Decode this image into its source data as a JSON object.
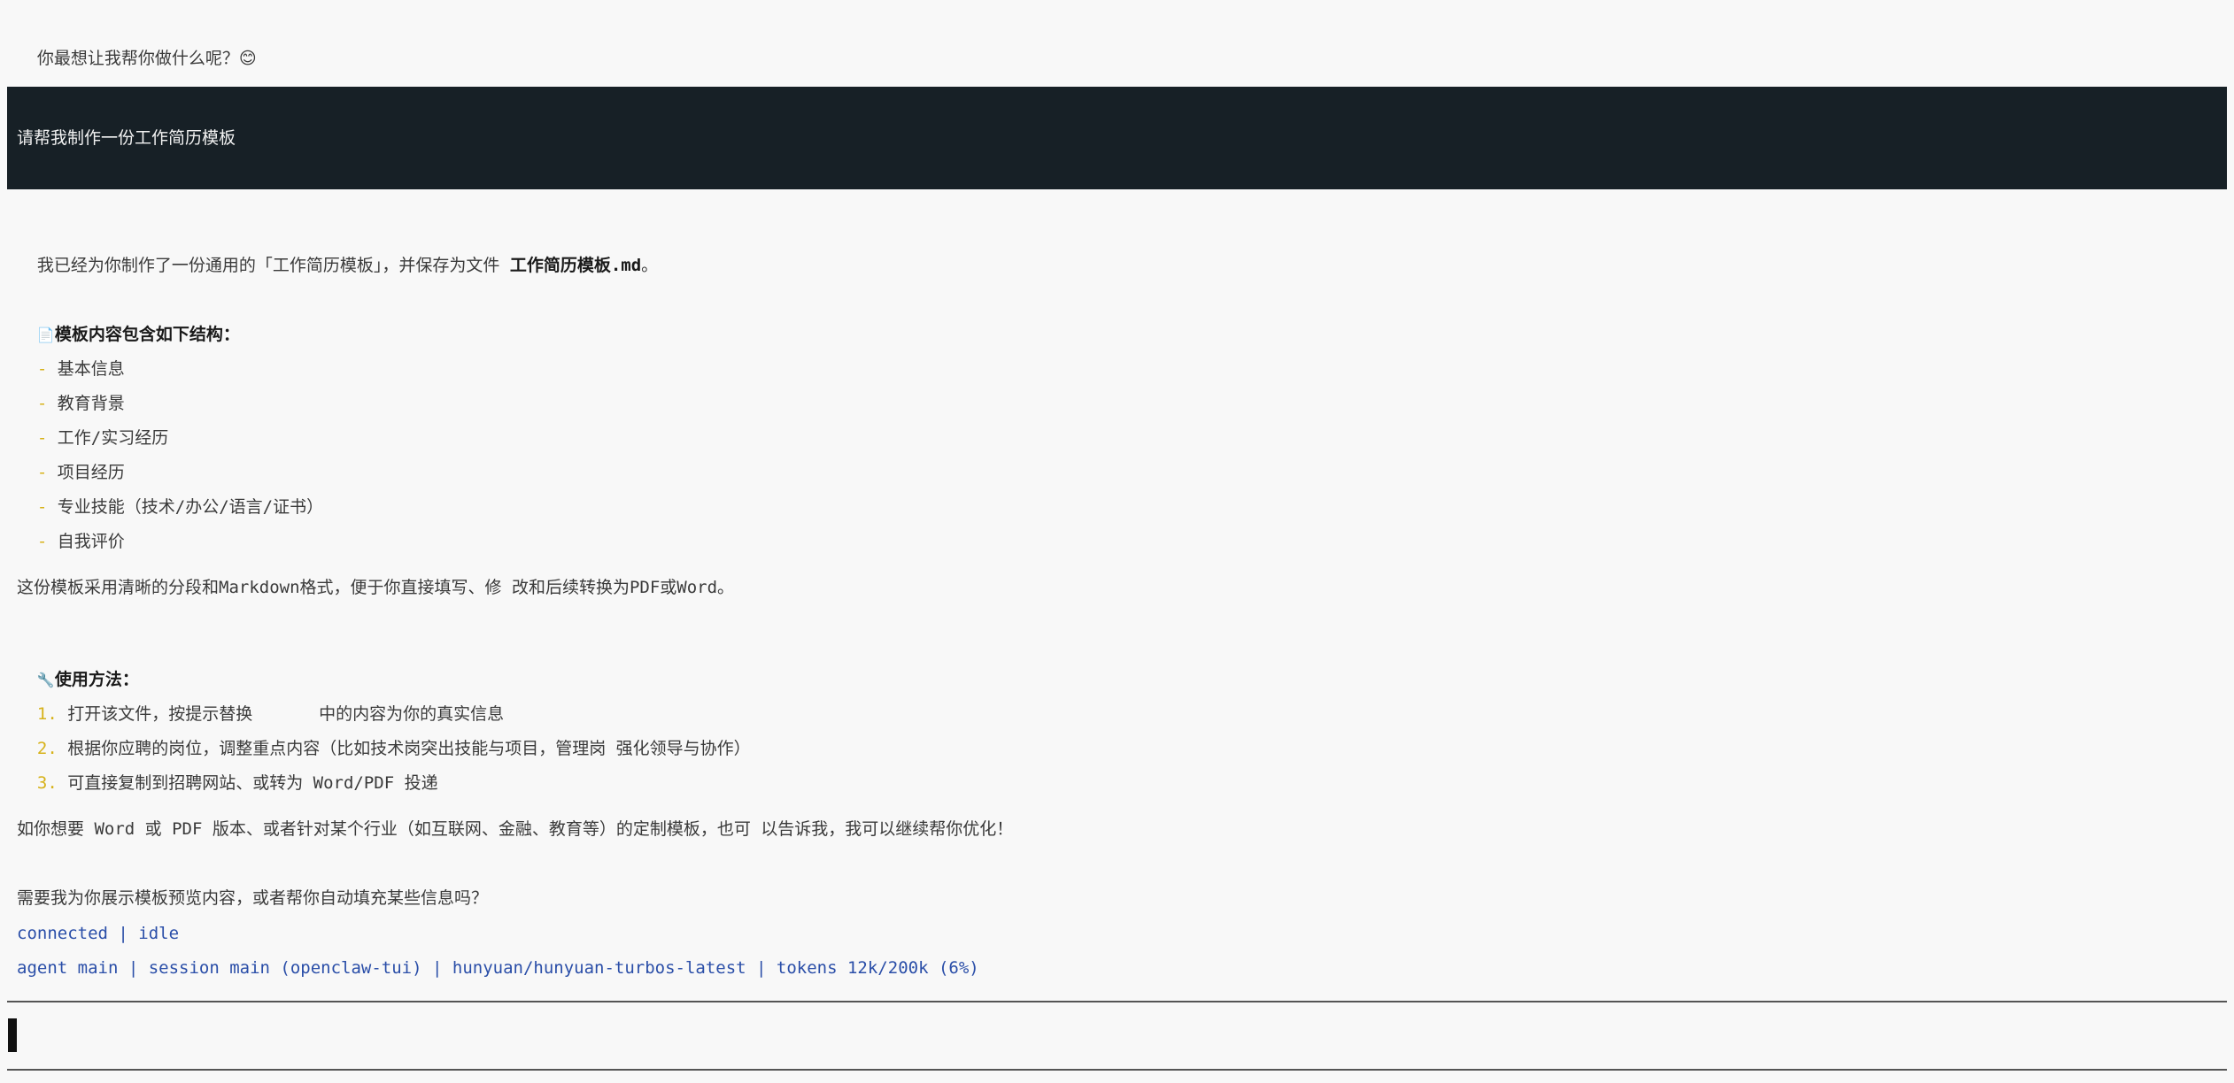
{
  "greeting": {
    "text": "你最想让我帮你做什么呢？",
    "emoji": "😊"
  },
  "user_message": "请帮我制作一份工作简历模板",
  "reply": {
    "intro_prefix": "我已经为你制作了一份通用的「工作简历模板」，并保存为文件 ",
    "intro_file": "工作简历模板.md",
    "intro_suffix": "。",
    "structure_icon": "📄",
    "structure_title": "模板内容包含如下结构：",
    "structure_items": [
      {
        "bullet": "-",
        "label": "基本信息"
      },
      {
        "bullet": "-",
        "label": "教育背景"
      },
      {
        "bullet": "-",
        "label": "工作/实习经历"
      },
      {
        "bullet": "-",
        "label": "项目经历"
      },
      {
        "bullet": "-",
        "label": "专业技能（技术/办公/语言/证书）"
      },
      {
        "bullet": "-",
        "label": "自我评价"
      }
    ],
    "format_note": "这份模板采用清晰的分段和Markdown格式，便于你直接填写、修 改和后续转换为PDF或Word。",
    "usage_icon": "🔧",
    "usage_title": "使用方法：",
    "usage_steps": [
      {
        "num": "1.",
        "pre": "打开该文件，按提示替换 ",
        "post": " 中的内容为你的真实信息"
      },
      {
        "num": "2.",
        "pre": "根据你应聘的岗位，调整重点内容（比如技术岗突出技能与项目，管理岗 强化领导与协作）",
        "post": ""
      },
      {
        "num": "3.",
        "pre": "可直接复制到招聘网站、或转为 Word/PDF 投递",
        "post": ""
      }
    ],
    "offer": "如你想要 Word 或 PDF 版本、或者针对某个行业（如互联网、金融、教育等）的定制模板，也可 以告诉我，我可以继续帮你优化！",
    "question": "需要我为你展示模板预览内容，或者帮你自动填充某些信息吗？"
  },
  "status": {
    "connection": "connected | idle",
    "session": "agent main | session main (openclaw-tui) | hunyuan/hunyuan-turbos-latest | tokens 12k/200k (6%)"
  },
  "input": {
    "value": ""
  }
}
